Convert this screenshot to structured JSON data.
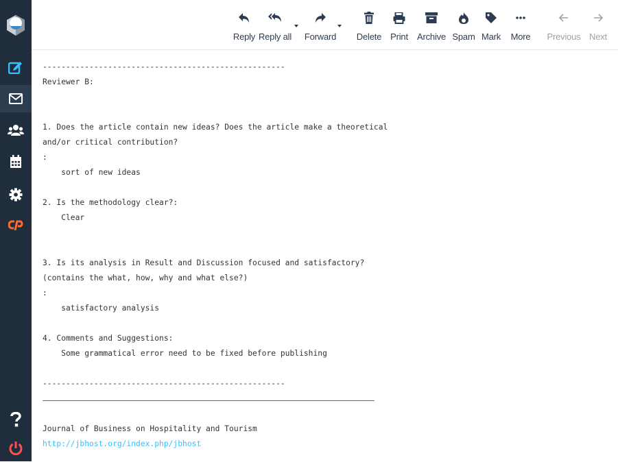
{
  "toolbar": {
    "reply": "Reply",
    "reply_all": "Reply all",
    "forward": "Forward",
    "delete": "Delete",
    "print": "Print",
    "archive": "Archive",
    "spam": "Spam",
    "mark": "Mark",
    "more": "More",
    "previous": "Previous",
    "next": "Next"
  },
  "sidebar": {
    "items": [
      "compose-icon",
      "mail-icon",
      "contacts-icon",
      "calendar-icon",
      "settings-icon",
      "cpanel-icon",
      "dark-mode-icon",
      "help-icon",
      "logout-icon"
    ]
  },
  "message": {
    "lines": [
      "----------------------------------------------------",
      "Reviewer B:",
      "1. Does the article contain new ideas? Does the article make a theoretical",
      "and/or critical contribution?",
      ":",
      "    sort of new ideas",
      "2. Is the methodology clear?:",
      "    Clear",
      "3. Is its analysis in Result and Discussion focused and satisfactory?",
      "(contains the what, how, why and what else?)",
      ":",
      "    satisfactory analysis",
      "4. Comments and Suggestions:",
      "    Some grammatical error need to be fixed before publishing",
      "----------------------------------------------------",
      "Journal of Business on Hospitality and Tourism"
    ],
    "link": "http://jbhost.org/index.php/jbhost"
  },
  "colors": {
    "sidebar_bg": "#1f2d3c",
    "sidebar_active": "#2c3d51",
    "accent": "#37beff",
    "cpanel": "#ff6c2c",
    "logout": "#ff4f4f"
  }
}
